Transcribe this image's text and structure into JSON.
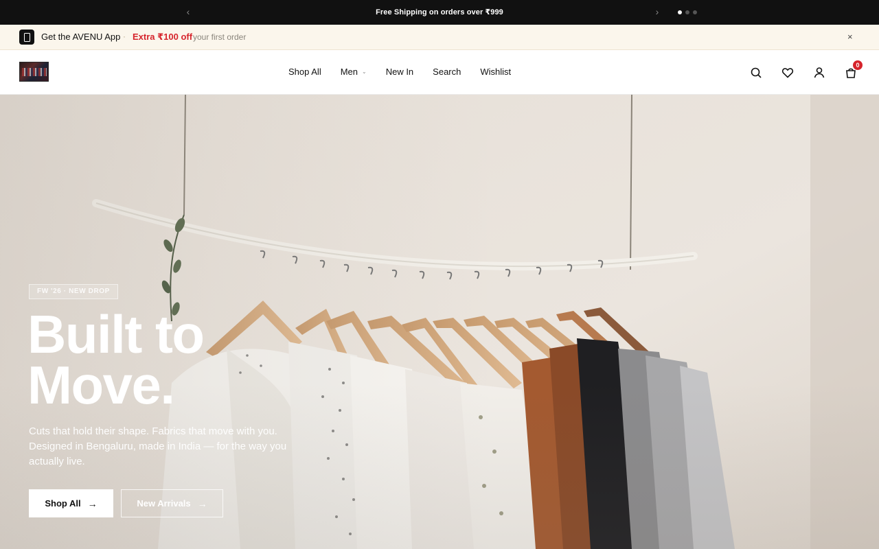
{
  "announcement": {
    "message": "Free Shipping on orders over ₹999",
    "prev_icon": "chevron-left-icon",
    "next_icon": "chevron-right-icon",
    "dots": 3,
    "active_dot": 0
  },
  "app_promo": {
    "title": "Get the AVENU App",
    "separator": "·",
    "offer": "Extra ₹100 off",
    "sub": "your first order",
    "close": "×"
  },
  "header": {
    "nav": [
      {
        "label": "Shop All"
      },
      {
        "label": "Men",
        "has_dropdown": true
      },
      {
        "label": "New In"
      },
      {
        "label": "Search"
      },
      {
        "label": "Wishlist"
      }
    ],
    "cart_count": "0",
    "icons": [
      "search-icon",
      "heart-icon",
      "user-icon",
      "cart-icon"
    ]
  },
  "hero": {
    "tag": "FW '26 · NEW DROP",
    "headline_line1": "Built to",
    "headline_line2": "Move.",
    "description": "Cuts that hold their shape. Fabrics that move with you. Designed in Bengaluru, made in India — for the way you actually live.",
    "primary_button": "Shop All",
    "secondary_button": "New Arrivals"
  },
  "colors": {
    "announce_bg": "#111111",
    "promo_bg": "#fbf6ec",
    "offer_red": "#d6242c",
    "badge_red": "#d6242c"
  }
}
